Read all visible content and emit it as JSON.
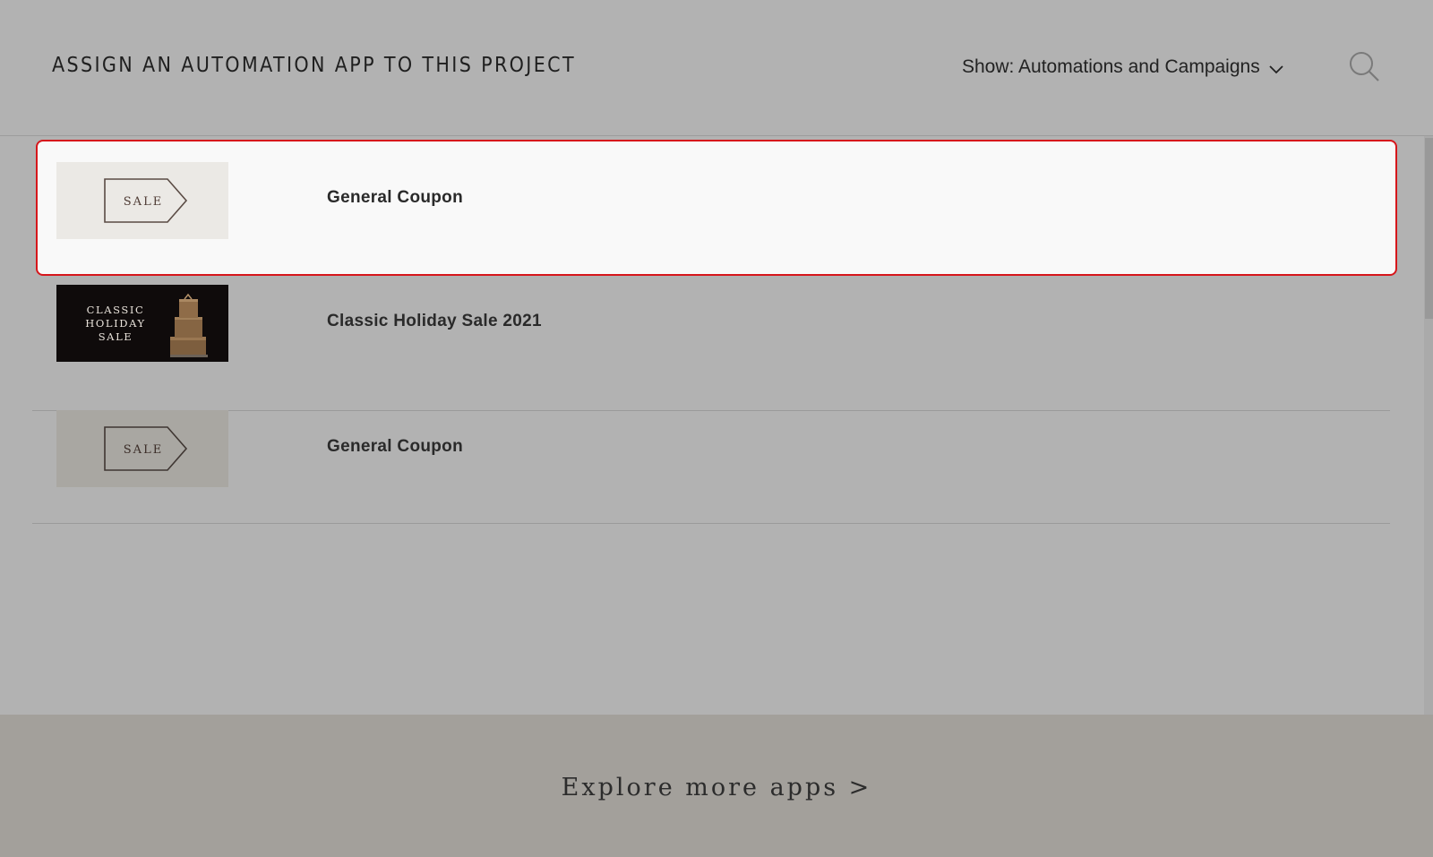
{
  "header": {
    "title": "ASSIGN AN AUTOMATION APP TO THIS PROJECT",
    "filter_label": "Show: Automations and Campaigns",
    "filter_icon": "chevron-down-icon",
    "search_icon": "search-icon"
  },
  "apps": [
    {
      "name": "General Coupon",
      "thumbnail": {
        "kind": "sale-tag",
        "text": "SALE"
      },
      "selected": true
    },
    {
      "name": "Classic Holiday Sale 2021",
      "thumbnail": {
        "kind": "holiday-banner",
        "line1": "CLASSIC",
        "line2": "HOLIDAY",
        "line3": "SALE"
      },
      "selected": false
    },
    {
      "name": "General Coupon",
      "thumbnail": {
        "kind": "sale-tag",
        "text": "SALE"
      },
      "selected": false
    }
  ],
  "footer": {
    "explore_label": "Explore more apps >"
  },
  "colors": {
    "selection_border": "#d6161b",
    "overlay_background": "#b2b2b2",
    "footer_background": "#a3a09b"
  }
}
